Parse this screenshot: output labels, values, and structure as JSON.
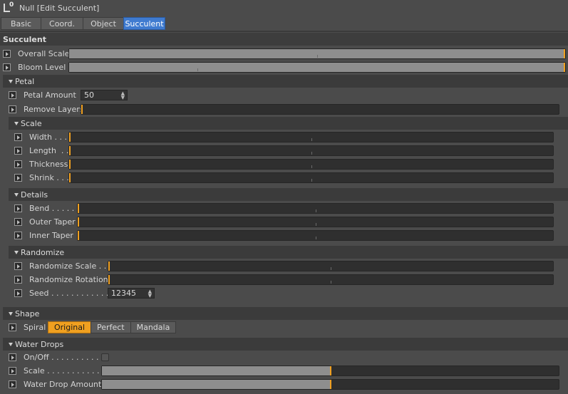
{
  "title": "Null [Edit Succulent]",
  "tabs": [
    "Basic",
    "Coord.",
    "Object",
    "Succulent"
  ],
  "sections": {
    "succulent": "Succulent",
    "petal": "Petal",
    "scale": "Scale",
    "details": "Details",
    "randomize": "Randomize",
    "shape": "Shape",
    "water": "Water Drops"
  },
  "params": {
    "overall_scale": "Overall Scale",
    "bloom_level": "Bloom Level",
    "petal_amount": "Petal Amount",
    "petal_amount_value": "50",
    "remove_layers": "Remove Layers",
    "width": "Width . . .",
    "length": "Length  . .",
    "thickness": "Thickness",
    "shrink": "Shrink . . .",
    "bend": "Bend . . . . . .",
    "outer_taper": "Outer Taper",
    "inner_taper": "Inner Taper",
    "randomize_scale": "Randomize Scale . . .",
    "randomize_rotation": "Randomize Rotation",
    "seed": "Seed . . . . . . . . . . . . . .",
    "seed_value": "12345",
    "spiral": "Spiral",
    "on_off": "On/Off . . . . . . . . . . . .",
    "water_scale": "Scale . . . . . . . . . . . . .",
    "water_drop_amount": "Water Drop Amount"
  },
  "spiral_options": [
    "Original",
    "Perfect",
    "Mandala"
  ],
  "spiral_selected": "Original",
  "slider_levels": {
    "overall_scale": 1.0,
    "bloom_level": 1.0,
    "remove_layers": 0.0,
    "width": 0.0,
    "length": 0.0,
    "thickness": 0.0,
    "shrink": 0.0,
    "bend": 0.0,
    "outer_taper": 0.0,
    "inner_taper": 0.0,
    "randomize_scale": 0.0,
    "randomize_rotation": 0.0,
    "water_scale": 0.5,
    "water_drop_amount": 0.5
  },
  "colors": {
    "accent": "#f0a020",
    "active_tab": "#3f7bd0"
  }
}
